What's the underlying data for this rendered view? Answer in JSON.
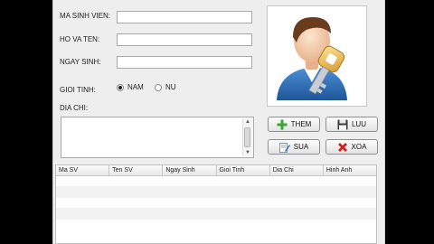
{
  "form": {
    "ma_sinh_vien_label": "MA SINH VIEN:",
    "ho_va_ten_label": "HO VA TEN:",
    "ngay_sinh_label": "NGAY SINH:",
    "gioi_tinh_label": "GIOI TINH:",
    "nam_label": "NAM",
    "nu_label": "NU",
    "dia_chi_label": "DIA CHI:",
    "ma_sinh_vien_value": "",
    "ho_va_ten_value": "",
    "ngay_sinh_value": "",
    "dia_chi_value": "",
    "selected_gender": "NAM"
  },
  "buttons": {
    "them": "THEM",
    "luu": "LUU",
    "sua": "SUA",
    "xoa": "XOA"
  },
  "table": {
    "columns": [
      "Ma SV",
      "Ten SV",
      "Ngay Sinh",
      "Gioi Tinh",
      "Dia Chi",
      "Hinh Anh"
    ],
    "rows": []
  },
  "colors": {
    "window_bg": "#eeeeee",
    "avatar_shirt": "#2e6fb8",
    "key": "#e8b04a",
    "add_green": "#3aa53a",
    "delete_red": "#d21f1f"
  },
  "icons": {
    "avatar": "user-key-icon",
    "them": "plus-icon",
    "luu": "floppy-disk-icon",
    "sua": "edit-document-icon",
    "xoa": "red-x-icon"
  }
}
